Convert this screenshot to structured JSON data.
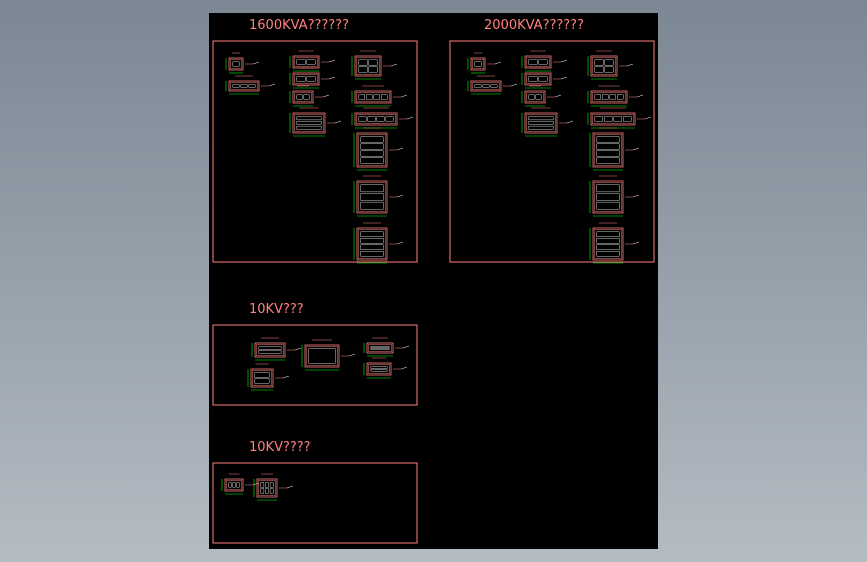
{
  "sections": [
    {
      "title": "1600KVA??????"
    },
    {
      "title": "2000KVA??????"
    },
    {
      "title": "10KV???"
    },
    {
      "title": "10KV????"
    }
  ],
  "colors": {
    "background": "#000000",
    "frame": "#ff8080",
    "dimension": "#00ff00",
    "title": "#ff8080"
  }
}
